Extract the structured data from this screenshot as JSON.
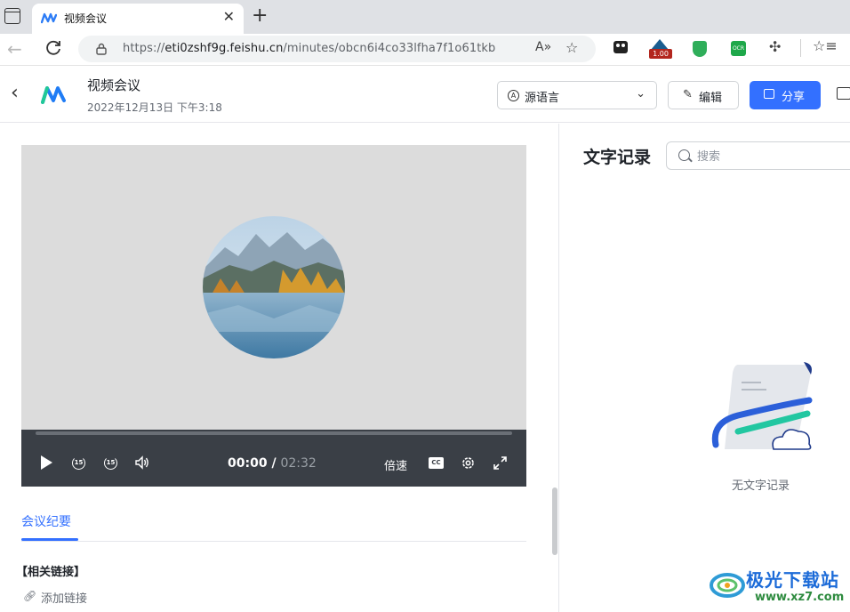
{
  "browser": {
    "tab_title": "视频会议",
    "url_prefix": "https://",
    "url_host": "eti0zshf9g.feishu.cn",
    "url_path": "/minutes/obcn6i4co33lfha7f1o61tkb",
    "ext_badge_value": "1.00",
    "ext_ocr_label": "OCR"
  },
  "header": {
    "title": "视频会议",
    "date": "2022年12月13日 下午3:18",
    "language_select": "源语言",
    "edit_label": "编辑",
    "share_label": "分享"
  },
  "player": {
    "current_time": "00:00",
    "separator": " / ",
    "total_time": "02:32",
    "progress": 0,
    "skip_seconds": "15",
    "speed_label": "倍速",
    "cc_label": "CC"
  },
  "summary": {
    "tab_label": "会议纪要",
    "links_title": "【相关链接】",
    "add_link_label": "添加链接"
  },
  "transcript": {
    "title": "文字记录",
    "search_placeholder": "搜索",
    "empty_text": "无文字记录"
  },
  "watermark": {
    "name": "极光下载站",
    "url": "www.xz7.com"
  },
  "colors": {
    "primary": "#3370ff",
    "player_bar": "#3a3f46"
  }
}
